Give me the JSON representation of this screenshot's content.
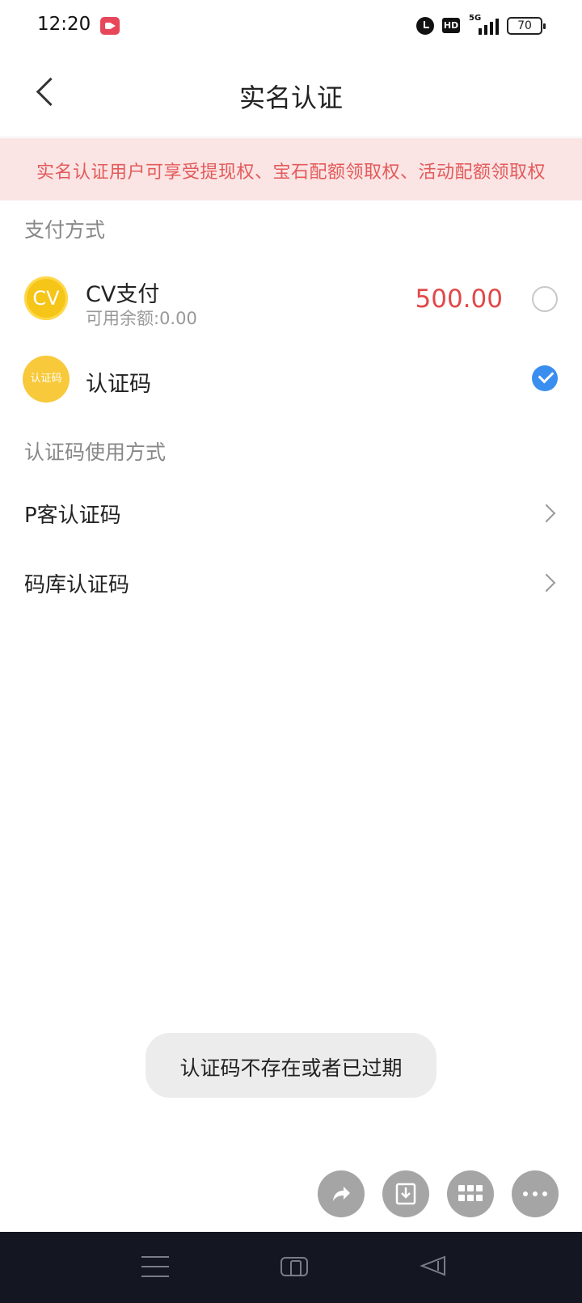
{
  "status_bar": {
    "time": "12:20",
    "network": "5G",
    "hd": "HD",
    "battery": "70",
    "icons": [
      "screen-record-icon",
      "alarm-icon",
      "hd-icon",
      "signal-icon",
      "battery-icon"
    ]
  },
  "header": {
    "title": "实名认证",
    "back_icon": "chevron-left-icon"
  },
  "notice": {
    "text": "实名认证用户可享受提现权、宝石配额领取权、活动配额领取权",
    "color": "#e35a5a",
    "background": "#fbe4e4"
  },
  "payment": {
    "section_label": "支付方式",
    "options": [
      {
        "icon_text": "CV",
        "name": "CV支付",
        "sub": "可用余额:0.00",
        "amount": "500.00",
        "selected": false
      },
      {
        "icon_text": "认证码",
        "name": "认证码",
        "selected": true
      }
    ]
  },
  "code_methods": {
    "section_label": "认证码使用方式",
    "items": [
      {
        "label": "P客认证码"
      },
      {
        "label": "码库认证码"
      }
    ]
  },
  "toast": {
    "text": "认证码不存在或者已过期"
  },
  "fabs": [
    "share-icon",
    "download-icon",
    "grid-icon",
    "more-icon"
  ],
  "system_nav": [
    "menu-icon",
    "home-icon",
    "back-icon"
  ],
  "colors": {
    "accent_blue": "#3a8ef0",
    "amount_red": "#e24848",
    "coin_yellow": "#f5c518"
  }
}
